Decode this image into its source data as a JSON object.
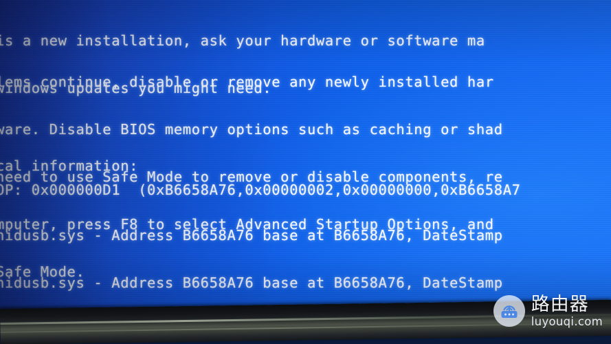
{
  "screen": {
    "kind": "windows-blue-screen-of-death",
    "background_color": "#1060e8",
    "text_color": "#f2f6ff",
    "note_cropped": "photo of a monitor; text is clipped at the left and right edges",
    "paragraphs": {
      "intro": [
        "is a new installation, ask your hardware or software ma",
        "windows updates you might need."
      ],
      "steps": [
        "lems continue, disable or remove any newly installed har",
        "ware. Disable BIOS memory options such as caching or shad",
        "need to use Safe Mode to remove or disable components, re",
        "mputer, press F8 to select Advanced Startup Options, and",
        "Safe Mode."
      ],
      "technical_header": "cal information:",
      "stop_line": "OP: 0x000000D1  (0xB6658A76,0x00000002,0x00000000,0xB6658A7",
      "driver_lines": [
        "hidusb.sys - Address B6658A76 base at B6658A76, DateStamp",
        "hidusb.sys - Address B6658A76 base at B6658A76, DateStamp"
      ]
    },
    "stop_code": {
      "code": "0x000000D1",
      "parameters": [
        "0xB6658A76",
        "0x00000002",
        "0x00000000",
        "0xB6658A7"
      ],
      "faulting_module": "hidusb.sys",
      "address": "B6658A76",
      "base": "B6658A76"
    }
  },
  "watermark": {
    "icon": "router-icon",
    "title_cn": "路由器",
    "url": "luyouqi.com",
    "badge_color": "#ecf2fc",
    "text_color": "#ffffff"
  },
  "bezel": {
    "label": "monitor-bottom-bezel",
    "color": "#1c1f22"
  }
}
